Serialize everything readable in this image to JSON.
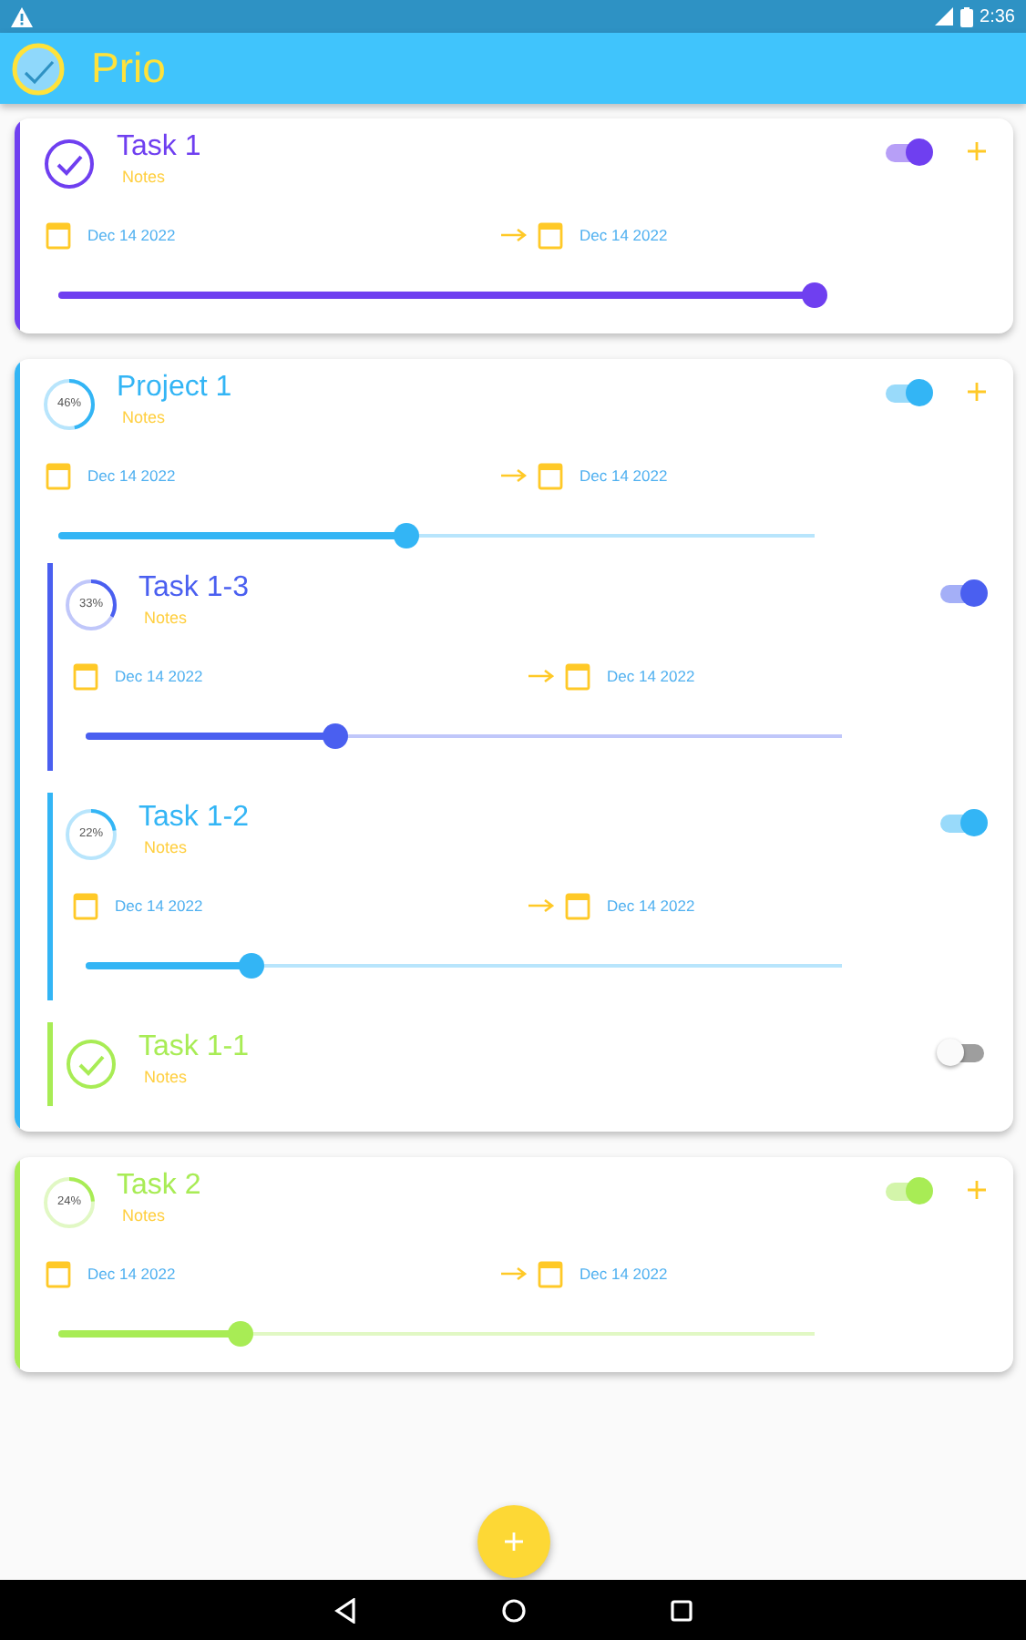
{
  "status_bar": {
    "time": "2:36"
  },
  "app_bar": {
    "title": "Prio"
  },
  "items": [
    {
      "kind": "task",
      "title": "Task 1",
      "notes": "Notes",
      "color": "#6f3ff0",
      "status": {
        "kind": "done"
      },
      "on": true,
      "has_add": true,
      "dates": {
        "start": "Dec 14 2022",
        "end": "Dec 14 2022"
      },
      "level": 1.0
    },
    {
      "kind": "project",
      "title": "Project 1",
      "notes": "Notes",
      "color": "#33b5f5",
      "status": {
        "kind": "progress",
        "label": "46%"
      },
      "on": true,
      "has_add": true,
      "dates": {
        "start": "Dec 14 2022",
        "end": "Dec 14 2022"
      },
      "level": 0.46,
      "children": [
        {
          "kind": "task",
          "title": "Task 1-3",
          "notes": "Notes",
          "color": "#4a5ff0",
          "status": {
            "kind": "progress",
            "label": "33%"
          },
          "on": true,
          "has_add": false,
          "dates": {
            "start": "Dec 14 2022",
            "end": "Dec 14 2022"
          },
          "level": 0.33
        },
        {
          "kind": "task",
          "title": "Task 1-2",
          "notes": "Notes",
          "color": "#33b5f5",
          "status": {
            "kind": "progress",
            "label": "22%"
          },
          "on": true,
          "has_add": false,
          "dates": {
            "start": "Dec 14 2022",
            "end": "Dec 14 2022"
          },
          "level": 0.22
        },
        {
          "kind": "task",
          "title": "Task 1-1",
          "notes": "Notes",
          "color": "#a8ec55",
          "status": {
            "kind": "done"
          },
          "on": false,
          "has_add": false
        }
      ]
    },
    {
      "kind": "task",
      "title": "Task 2",
      "notes": "Notes",
      "color": "#a8ec55",
      "status": {
        "kind": "progress",
        "label": "24%"
      },
      "on": true,
      "has_add": true,
      "dates": {
        "start": "Dec 14 2022",
        "end": "Dec 14 2022"
      },
      "level": 0.24
    }
  ]
}
